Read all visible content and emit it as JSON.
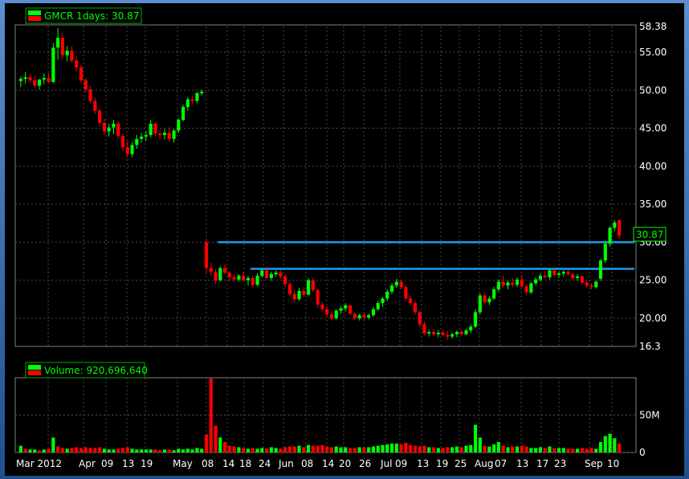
{
  "window": {
    "frame_color": "#2f66ad"
  },
  "colors": {
    "up": "#00ff00",
    "down": "#ff0000",
    "grid": "#4a4a4a",
    "support": "#1e9bea",
    "text": "#ffffff",
    "legend": "#00ff00"
  },
  "chart_data": [
    {
      "type": "candlestick",
      "legend": "GMCR 1days: 30.87",
      "last_price": "30.87",
      "ylim": [
        16.3,
        58.38
      ],
      "y_ticks": [
        "58.38",
        "55.00",
        "50.00",
        "45.00",
        "40.00",
        "35.00",
        "30.00",
        "25.00",
        "20.00",
        "16.3"
      ],
      "y_tick_values": [
        58.38,
        55,
        50,
        45,
        40,
        35,
        30,
        25,
        20,
        16.3
      ],
      "x_labels": [
        "Mar 2012",
        "Apr",
        "09",
        "13",
        "19",
        "May",
        "08",
        "14",
        "18",
        "24",
        "Jun",
        "08",
        "14",
        "20",
        "26",
        "Jul",
        "09",
        "13",
        "19",
        "25",
        "Aug",
        "07",
        "13",
        "17",
        "23",
        "Sep",
        "10"
      ],
      "support_lines": [
        {
          "value": 30.0,
          "from_index": 43,
          "to_index": 157
        },
        {
          "value": 26.5,
          "from_index": 50,
          "to_index": 157
        }
      ],
      "ohlc": [
        [
          51.2,
          51.8,
          50.4,
          51.5
        ],
        [
          51.5,
          52.4,
          50.9,
          51.7
        ],
        [
          51.7,
          52.2,
          51.0,
          51.3
        ],
        [
          51.3,
          51.9,
          50.3,
          50.6
        ],
        [
          50.6,
          51.5,
          50.1,
          51.4
        ],
        [
          51.4,
          52.2,
          50.8,
          51.6
        ],
        [
          51.6,
          52.3,
          51.0,
          51.1
        ],
        [
          51.1,
          56.2,
          50.9,
          55.6
        ],
        [
          55.6,
          58.2,
          54.0,
          56.9
        ],
        [
          56.9,
          57.5,
          54.1,
          54.6
        ],
        [
          54.6,
          55.8,
          53.8,
          55.2
        ],
        [
          55.2,
          55.8,
          53.6,
          53.9
        ],
        [
          53.9,
          54.5,
          52.5,
          53.0
        ],
        [
          53.0,
          53.3,
          51.0,
          51.3
        ],
        [
          51.3,
          51.6,
          49.7,
          50.1
        ],
        [
          50.1,
          50.6,
          48.3,
          48.6
        ],
        [
          48.6,
          49.0,
          46.9,
          47.3
        ],
        [
          47.3,
          47.6,
          45.3,
          45.7
        ],
        [
          45.7,
          46.3,
          44.1,
          44.6
        ],
        [
          44.6,
          45.6,
          43.9,
          45.1
        ],
        [
          45.1,
          46.1,
          44.2,
          45.6
        ],
        [
          45.6,
          45.9,
          43.6,
          44.0
        ],
        [
          44.0,
          44.3,
          42.0,
          42.5
        ],
        [
          42.5,
          43.3,
          41.1,
          41.6
        ],
        [
          41.6,
          43.2,
          41.2,
          42.8
        ],
        [
          42.8,
          44.1,
          42.3,
          43.6
        ],
        [
          43.6,
          44.4,
          43.1,
          43.9
        ],
        [
          43.9,
          44.6,
          43.3,
          44.1
        ],
        [
          44.1,
          46.1,
          43.8,
          45.6
        ],
        [
          45.6,
          45.8,
          43.9,
          44.3
        ],
        [
          44.3,
          44.8,
          43.6,
          44.1
        ],
        [
          44.1,
          44.9,
          43.5,
          44.4
        ],
        [
          44.4,
          45.1,
          43.2,
          43.6
        ],
        [
          43.6,
          44.9,
          43.1,
          44.7
        ],
        [
          44.7,
          46.3,
          44.4,
          46.1
        ],
        [
          46.1,
          48.1,
          45.9,
          47.8
        ],
        [
          47.8,
          49.1,
          47.3,
          48.8
        ],
        [
          48.8,
          49.3,
          48.2,
          48.6
        ],
        [
          48.6,
          49.8,
          48.3,
          49.6
        ],
        [
          49.6,
          50.1,
          49.3,
          49.8
        ],
        [
          30.0,
          30.5,
          25.8,
          26.6
        ],
        [
          26.6,
          27.3,
          25.6,
          26.1
        ],
        [
          26.1,
          26.5,
          24.6,
          25.0
        ],
        [
          25.0,
          26.8,
          24.8,
          26.6
        ],
        [
          26.6,
          27.1,
          25.8,
          26.0
        ],
        [
          26.0,
          26.2,
          24.9,
          25.4
        ],
        [
          25.4,
          25.8,
          24.8,
          25.1
        ],
        [
          25.1,
          25.8,
          24.8,
          25.6
        ],
        [
          25.6,
          26.1,
          24.9,
          25.0
        ],
        [
          25.0,
          25.6,
          24.3,
          25.3
        ],
        [
          25.3,
          25.6,
          24.1,
          24.4
        ],
        [
          24.4,
          25.9,
          24.2,
          25.6
        ],
        [
          25.6,
          26.5,
          25.4,
          26.3
        ],
        [
          26.3,
          26.8,
          25.1,
          25.3
        ],
        [
          25.3,
          26.1,
          24.9,
          25.8
        ],
        [
          25.8,
          26.3,
          25.5,
          26.0
        ],
        [
          26.0,
          26.4,
          25.2,
          25.5
        ],
        [
          25.5,
          25.8,
          24.1,
          24.5
        ],
        [
          24.5,
          24.8,
          22.8,
          23.2
        ],
        [
          23.2,
          23.8,
          22.0,
          22.5
        ],
        [
          22.5,
          24.0,
          22.3,
          23.6
        ],
        [
          23.6,
          24.1,
          22.8,
          23.1
        ],
        [
          23.1,
          25.3,
          23.0,
          25.0
        ],
        [
          25.0,
          25.3,
          23.4,
          23.7
        ],
        [
          23.7,
          23.9,
          21.4,
          21.8
        ],
        [
          21.8,
          22.1,
          20.9,
          21.2
        ],
        [
          21.2,
          21.6,
          20.1,
          20.5
        ],
        [
          20.5,
          20.8,
          19.7,
          20.0
        ],
        [
          20.0,
          21.2,
          19.8,
          21.0
        ],
        [
          21.0,
          21.6,
          20.6,
          21.3
        ],
        [
          21.3,
          22.0,
          20.9,
          21.7
        ],
        [
          21.7,
          21.8,
          20.4,
          20.6
        ],
        [
          20.6,
          20.8,
          19.8,
          20.0
        ],
        [
          20.0,
          20.6,
          19.7,
          20.4
        ],
        [
          20.4,
          20.7,
          19.8,
          20.1
        ],
        [
          20.1,
          20.6,
          19.9,
          20.4
        ],
        [
          20.4,
          21.5,
          20.2,
          21.2
        ],
        [
          21.2,
          22.3,
          21.0,
          22.0
        ],
        [
          22.0,
          22.8,
          21.5,
          22.6
        ],
        [
          22.6,
          23.8,
          22.3,
          23.5
        ],
        [
          23.5,
          24.6,
          23.2,
          24.3
        ],
        [
          24.3,
          25.2,
          24.0,
          24.8
        ],
        [
          24.8,
          25.0,
          23.8,
          24.1
        ],
        [
          24.1,
          24.4,
          22.2,
          22.6
        ],
        [
          22.6,
          23.0,
          21.7,
          22.0
        ],
        [
          22.0,
          22.3,
          20.5,
          20.8
        ],
        [
          20.8,
          21.0,
          18.8,
          19.2
        ],
        [
          19.2,
          19.6,
          17.8,
          18.0
        ],
        [
          18.0,
          18.5,
          17.6,
          18.2
        ],
        [
          18.2,
          18.6,
          17.7,
          17.9
        ],
        [
          17.9,
          18.4,
          17.5,
          18.1
        ],
        [
          18.1,
          18.5,
          17.6,
          17.8
        ],
        [
          17.8,
          18.3,
          17.2,
          17.6
        ],
        [
          17.6,
          18.1,
          17.3,
          17.9
        ],
        [
          17.9,
          18.4,
          17.5,
          18.2
        ],
        [
          18.2,
          18.5,
          17.7,
          17.9
        ],
        [
          17.9,
          18.6,
          17.8,
          18.4
        ],
        [
          18.4,
          19.2,
          18.1,
          18.9
        ],
        [
          18.9,
          21.2,
          18.7,
          20.8
        ],
        [
          20.8,
          23.3,
          20.5,
          23.0
        ],
        [
          23.0,
          23.4,
          21.8,
          22.1
        ],
        [
          22.1,
          22.9,
          21.7,
          22.6
        ],
        [
          22.6,
          24.1,
          22.4,
          23.8
        ],
        [
          23.8,
          25.1,
          23.5,
          24.8
        ],
        [
          24.8,
          25.6,
          24.0,
          24.3
        ],
        [
          24.3,
          25.0,
          23.8,
          24.7
        ],
        [
          24.7,
          25.3,
          24.1,
          24.4
        ],
        [
          24.4,
          25.4,
          24.1,
          25.1
        ],
        [
          25.1,
          25.7,
          24.0,
          24.2
        ],
        [
          24.2,
          24.5,
          23.0,
          23.4
        ],
        [
          23.4,
          24.8,
          23.2,
          24.6
        ],
        [
          24.6,
          25.4,
          24.3,
          25.1
        ],
        [
          25.1,
          25.9,
          24.8,
          25.6
        ],
        [
          25.6,
          26.2,
          25.2,
          25.4
        ],
        [
          25.4,
          26.6,
          25.1,
          26.3
        ],
        [
          26.3,
          26.5,
          25.4,
          25.7
        ],
        [
          25.7,
          26.2,
          25.3,
          25.9
        ],
        [
          25.9,
          26.3,
          25.5,
          26.1
        ],
        [
          26.1,
          26.4,
          25.6,
          25.8
        ],
        [
          25.8,
          26.0,
          25.1,
          25.3
        ],
        [
          25.3,
          25.8,
          24.9,
          25.5
        ],
        [
          25.5,
          25.6,
          24.4,
          24.7
        ],
        [
          24.7,
          24.9,
          24.0,
          24.3
        ],
        [
          24.3,
          24.6,
          23.8,
          24.1
        ],
        [
          24.1,
          25.0,
          23.9,
          24.8
        ],
        [
          25.2,
          27.8,
          24.9,
          27.6
        ],
        [
          27.6,
          30.2,
          27.3,
          29.8
        ],
        [
          29.8,
          32.1,
          29.4,
          31.9
        ],
        [
          31.9,
          32.9,
          31.5,
          32.6
        ],
        [
          32.9,
          33.0,
          30.4,
          30.87
        ]
      ]
    },
    {
      "type": "bar",
      "legend": "Volume: 920,696,640",
      "ylim": [
        0,
        100
      ],
      "y_ticks": [
        "50M",
        "0"
      ],
      "y_tick_values": [
        50,
        0
      ],
      "values": [
        [
          9,
          1
        ],
        [
          5,
          0
        ],
        [
          4,
          1
        ],
        [
          4,
          1
        ],
        [
          3,
          0
        ],
        [
          4,
          1
        ],
        [
          5,
          0
        ],
        [
          20,
          1
        ],
        [
          8,
          0
        ],
        [
          6,
          0
        ],
        [
          5,
          1
        ],
        [
          6,
          0
        ],
        [
          7,
          0
        ],
        [
          6,
          0
        ],
        [
          7,
          0
        ],
        [
          6,
          0
        ],
        [
          6,
          0
        ],
        [
          7,
          0
        ],
        [
          5,
          1
        ],
        [
          4,
          1
        ],
        [
          4,
          1
        ],
        [
          5,
          0
        ],
        [
          6,
          0
        ],
        [
          7,
          0
        ],
        [
          5,
          1
        ],
        [
          4,
          1
        ],
        [
          4,
          1
        ],
        [
          4,
          1
        ],
        [
          4,
          1
        ],
        [
          4,
          0
        ],
        [
          3,
          0
        ],
        [
          4,
          1
        ],
        [
          4,
          0
        ],
        [
          3,
          1
        ],
        [
          5,
          1
        ],
        [
          4,
          1
        ],
        [
          5,
          1
        ],
        [
          4,
          1
        ],
        [
          6,
          1
        ],
        [
          5,
          1
        ],
        [
          24,
          0
        ],
        [
          99,
          0
        ],
        [
          36,
          0
        ],
        [
          20,
          1
        ],
        [
          14,
          0
        ],
        [
          9,
          0
        ],
        [
          8,
          0
        ],
        [
          7,
          1
        ],
        [
          6,
          0
        ],
        [
          5,
          1
        ],
        [
          6,
          0
        ],
        [
          5,
          1
        ],
        [
          6,
          1
        ],
        [
          5,
          0
        ],
        [
          7,
          1
        ],
        [
          6,
          1
        ],
        [
          5,
          0
        ],
        [
          7,
          0
        ],
        [
          8,
          0
        ],
        [
          8,
          0
        ],
        [
          9,
          1
        ],
        [
          7,
          0
        ],
        [
          10,
          1
        ],
        [
          9,
          0
        ],
        [
          9,
          0
        ],
        [
          10,
          0
        ],
        [
          8,
          0
        ],
        [
          7,
          0
        ],
        [
          8,
          1
        ],
        [
          7,
          1
        ],
        [
          7,
          1
        ],
        [
          6,
          0
        ],
        [
          6,
          0
        ],
        [
          7,
          1
        ],
        [
          7,
          0
        ],
        [
          7,
          1
        ],
        [
          8,
          1
        ],
        [
          9,
          1
        ],
        [
          10,
          1
        ],
        [
          11,
          1
        ],
        [
          12,
          1
        ],
        [
          12,
          1
        ],
        [
          11,
          0
        ],
        [
          13,
          0
        ],
        [
          10,
          0
        ],
        [
          9,
          0
        ],
        [
          8,
          0
        ],
        [
          9,
          0
        ],
        [
          7,
          1
        ],
        [
          7,
          0
        ],
        [
          6,
          1
        ],
        [
          6,
          0
        ],
        [
          7,
          0
        ],
        [
          7,
          1
        ],
        [
          8,
          1
        ],
        [
          7,
          0
        ],
        [
          9,
          1
        ],
        [
          10,
          1
        ],
        [
          37,
          1
        ],
        [
          20,
          1
        ],
        [
          9,
          0
        ],
        [
          8,
          1
        ],
        [
          11,
          1
        ],
        [
          14,
          1
        ],
        [
          9,
          0
        ],
        [
          7,
          1
        ],
        [
          8,
          0
        ],
        [
          8,
          1
        ],
        [
          9,
          0
        ],
        [
          8,
          0
        ],
        [
          6,
          1
        ],
        [
          6,
          1
        ],
        [
          7,
          1
        ],
        [
          6,
          0
        ],
        [
          8,
          1
        ],
        [
          6,
          0
        ],
        [
          6,
          1
        ],
        [
          6,
          1
        ],
        [
          5,
          0
        ],
        [
          5,
          0
        ],
        [
          5,
          1
        ],
        [
          6,
          0
        ],
        [
          5,
          0
        ],
        [
          6,
          0
        ],
        [
          5,
          1
        ],
        [
          14,
          1
        ],
        [
          22,
          1
        ],
        [
          25,
          1
        ],
        [
          19,
          1
        ],
        [
          12,
          0
        ]
      ]
    }
  ]
}
